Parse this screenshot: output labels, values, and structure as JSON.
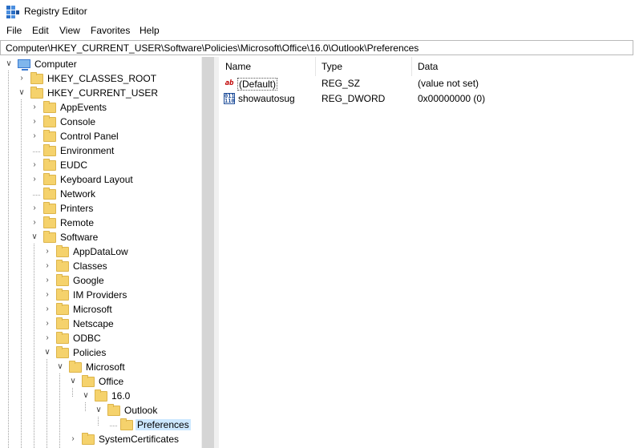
{
  "window": {
    "title": "Registry Editor",
    "icon": "regedit-icon"
  },
  "menu": [
    "File",
    "Edit",
    "View",
    "Favorites",
    "Help"
  ],
  "address": "Computer\\HKEY_CURRENT_USER\\Software\\Policies\\Microsoft\\Office\\16.0\\Outlook\\Preferences",
  "tree": [
    {
      "label": "Computer",
      "depth": 0,
      "state": "expanded",
      "icon": "computer-icon"
    },
    {
      "label": "HKEY_CLASSES_ROOT",
      "depth": 1,
      "state": "collapsed"
    },
    {
      "label": "HKEY_CURRENT_USER",
      "depth": 1,
      "state": "expanded"
    },
    {
      "label": "AppEvents",
      "depth": 2,
      "state": "collapsed"
    },
    {
      "label": "Console",
      "depth": 2,
      "state": "collapsed"
    },
    {
      "label": "Control Panel",
      "depth": 2,
      "state": "collapsed"
    },
    {
      "label": "Environment",
      "depth": 2,
      "state": "leaf"
    },
    {
      "label": "EUDC",
      "depth": 2,
      "state": "collapsed"
    },
    {
      "label": "Keyboard Layout",
      "depth": 2,
      "state": "collapsed"
    },
    {
      "label": "Network",
      "depth": 2,
      "state": "leaf"
    },
    {
      "label": "Printers",
      "depth": 2,
      "state": "collapsed"
    },
    {
      "label": "Remote",
      "depth": 2,
      "state": "collapsed"
    },
    {
      "label": "Software",
      "depth": 2,
      "state": "expanded"
    },
    {
      "label": "AppDataLow",
      "depth": 3,
      "state": "collapsed"
    },
    {
      "label": "Classes",
      "depth": 3,
      "state": "collapsed"
    },
    {
      "label": "Google",
      "depth": 3,
      "state": "collapsed"
    },
    {
      "label": "IM Providers",
      "depth": 3,
      "state": "collapsed"
    },
    {
      "label": "Microsoft",
      "depth": 3,
      "state": "collapsed"
    },
    {
      "label": "Netscape",
      "depth": 3,
      "state": "collapsed"
    },
    {
      "label": "ODBC",
      "depth": 3,
      "state": "collapsed"
    },
    {
      "label": "Policies",
      "depth": 3,
      "state": "expanded"
    },
    {
      "label": "Microsoft",
      "depth": 4,
      "state": "expanded"
    },
    {
      "label": "Office",
      "depth": 5,
      "state": "expanded"
    },
    {
      "label": "16.0",
      "depth": 6,
      "state": "expanded"
    },
    {
      "label": "Outlook",
      "depth": 7,
      "state": "expanded"
    },
    {
      "label": "Preferences",
      "depth": 8,
      "state": "leaf",
      "selected": true
    },
    {
      "label": "SystemCertificates",
      "depth": 5,
      "state": "collapsed"
    }
  ],
  "columns": {
    "name": "Name",
    "type": "Type",
    "data": "Data"
  },
  "values": [
    {
      "name": "(Default)",
      "type": "REG_SZ",
      "data": "(value not set)",
      "icon": "string-value-icon",
      "glyph": "ab"
    },
    {
      "name": "showautosug",
      "type": "REG_DWORD",
      "data": "0x00000000 (0)",
      "icon": "binary-value-icon",
      "glyph": "011 110"
    }
  ]
}
